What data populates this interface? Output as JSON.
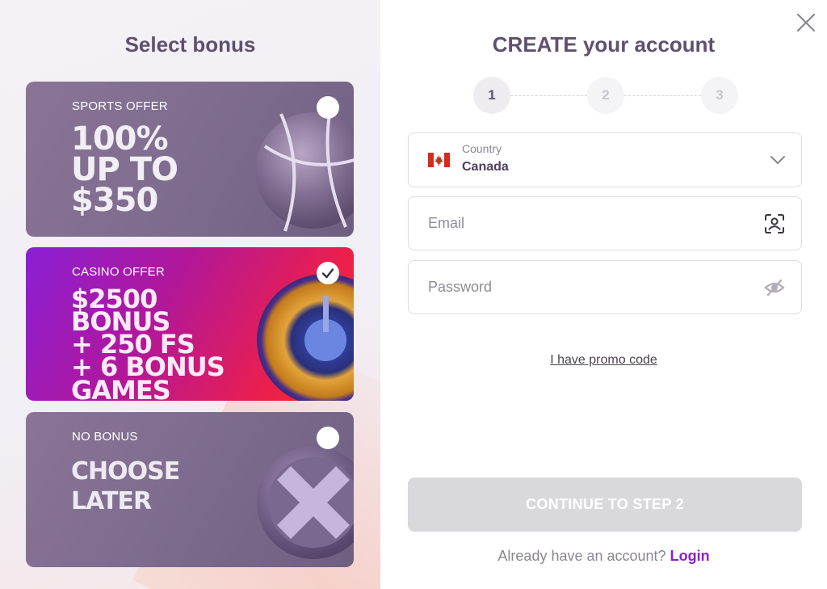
{
  "left": {
    "title": "Select bonus",
    "offers": [
      {
        "tag": "SPORTS OFFER",
        "lines": [
          "100%",
          "UP TO",
          "$350"
        ],
        "selected": false
      },
      {
        "tag": "CASINO OFFER",
        "lines": [
          "$2500",
          "BONUS",
          "+ 250 FS",
          "+ 6 BONUS",
          "GAMES"
        ],
        "selected": true
      },
      {
        "tag": "NO BONUS",
        "lines": [
          "CHOOSE",
          "LATER"
        ],
        "selected": false
      }
    ]
  },
  "right": {
    "title": "CREATE your account",
    "steps": [
      "1",
      "2",
      "3"
    ],
    "active_step": 1,
    "country": {
      "label": "Country",
      "value": "Canada"
    },
    "email": {
      "placeholder": "Email"
    },
    "password": {
      "placeholder": "Password"
    },
    "promo_link": "I have promo code",
    "continue_label": "CONTINUE TO STEP 2",
    "have_account": "Already have an account?",
    "login_label": "Login"
  },
  "colors": {
    "accent": "#8d1bd6",
    "title": "#5f5070",
    "disabled_button": "#d9d9db"
  }
}
